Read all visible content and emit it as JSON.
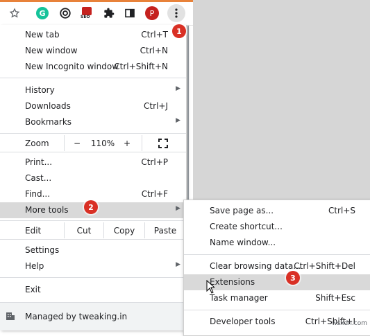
{
  "toolbar": {
    "icons": [
      "star-icon",
      "grammarly-icon",
      "extension-icon",
      "seo-icon",
      "puzzle-icon",
      "sidepanel-icon",
      "profile-avatar",
      "kebab-menu-icon"
    ],
    "profile_letter": "P",
    "seo_text": "SEO",
    "grammarly_letter": "G"
  },
  "menu": {
    "new_tab": {
      "label": "New tab",
      "shortcut": "Ctrl+T"
    },
    "new_window": {
      "label": "New window",
      "shortcut": "Ctrl+N"
    },
    "new_incognito": {
      "label": "New Incognito window",
      "shortcut": "Ctrl+Shift+N"
    },
    "history": {
      "label": "History"
    },
    "downloads": {
      "label": "Downloads",
      "shortcut": "Ctrl+J"
    },
    "bookmarks": {
      "label": "Bookmarks"
    },
    "zoom": {
      "label": "Zoom",
      "minus": "−",
      "value": "110%",
      "plus": "+"
    },
    "print": {
      "label": "Print...",
      "shortcut": "Ctrl+P"
    },
    "cast": {
      "label": "Cast..."
    },
    "find": {
      "label": "Find...",
      "shortcut": "Ctrl+F"
    },
    "more_tools": {
      "label": "More tools"
    },
    "edit": {
      "label": "Edit",
      "cut": "Cut",
      "copy": "Copy",
      "paste": "Paste"
    },
    "settings": {
      "label": "Settings"
    },
    "help": {
      "label": "Help"
    },
    "exit": {
      "label": "Exit"
    },
    "managed": {
      "label": "Managed by tweaking.in"
    }
  },
  "submenu": {
    "save_page": {
      "label": "Save page as...",
      "shortcut": "Ctrl+S"
    },
    "create_shortcut": {
      "label": "Create shortcut..."
    },
    "name_window": {
      "label": "Name window..."
    },
    "clear_browsing": {
      "label": "Clear browsing data...",
      "shortcut": "Ctrl+Shift+Del"
    },
    "extensions": {
      "label": "Extensions"
    },
    "task_manager": {
      "label": "Task manager",
      "shortcut": "Shift+Esc"
    },
    "developer_tools": {
      "label": "Developer tools",
      "shortcut": "Ctrl+Shift+I"
    }
  },
  "badges": [
    "1",
    "2",
    "3"
  ],
  "watermark": "wsxdn.com",
  "colors": {
    "badge": "#d93025",
    "highlight": "#d9d9d9",
    "accent_orange": "#e8823a"
  }
}
